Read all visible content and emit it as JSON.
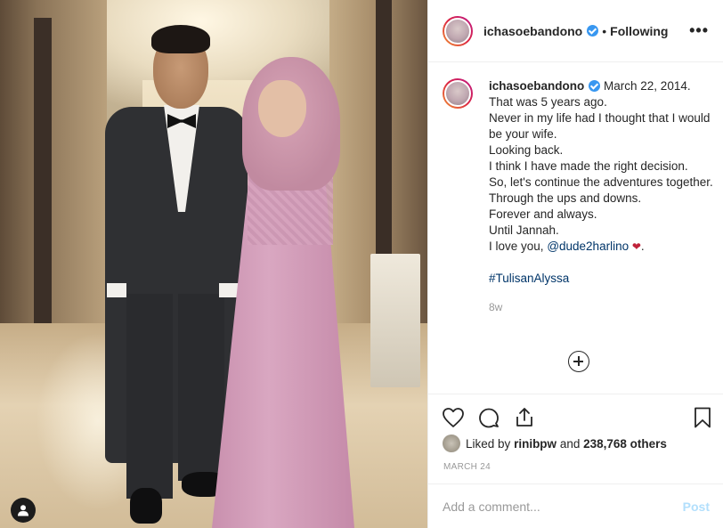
{
  "post": {
    "username": "ichasoebandono",
    "follow_status": "Following",
    "separator": "•",
    "more_label": "•••",
    "caption": {
      "date": "March 22, 2014.",
      "lines": [
        "That was 5 years ago.",
        "Never in my life had I thought that I would be your wife.",
        "Looking back.",
        "I think I have made the right decision.",
        "So, let's continue the adventures together.",
        "Through the ups and downs.",
        "Forever and always.",
        "Until Jannah."
      ],
      "love_prefix": "I love you,",
      "mention": "@dude2harlino",
      "heart": "❤",
      "love_suffix": ".",
      "hashtag": "#TulisanAlyssa",
      "age": "8w"
    },
    "likes": {
      "prefix": "Liked by",
      "user": "rinibpw",
      "joiner": "and",
      "count": "238,768 others"
    },
    "date": "MARCH 24",
    "comment": {
      "placeholder": "Add a comment...",
      "post_label": "Post"
    }
  },
  "colors": {
    "accent": "#3897f0",
    "link": "#003569",
    "post_disabled": "#b2dffc",
    "muted": "#999999"
  },
  "icons": [
    "verified-badge-icon",
    "more-options-icon",
    "load-more-comments-icon",
    "heart-icon",
    "comment-icon",
    "share-icon",
    "bookmark-icon",
    "user-tag-icon"
  ]
}
